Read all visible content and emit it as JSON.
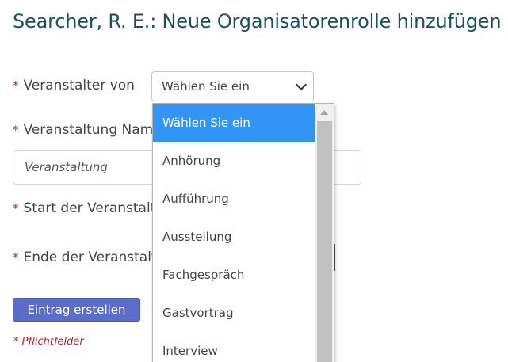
{
  "page": {
    "title": "Searcher, R. E.: Neue Organisatorenrolle hinzufügen"
  },
  "form": {
    "required_marker": "*",
    "organizer_label": "Veranstalter von",
    "organizer_select_value": "Wählen Sie ein",
    "event_name_label": "Veranstaltung Name",
    "event_name_placeholder": "Veranstaltung",
    "start_label": "Start der Veranstaltung",
    "end_label": "Ende der Veranstaltung",
    "submit_label": "Eintrag erstellen",
    "required_note": "* Pflichtfelder"
  },
  "dropdown": {
    "options": [
      "Wählen Sie ein",
      "Anhörung",
      "Aufführung",
      "Ausstellung",
      "Fachgespräch",
      "Gastvortrag",
      "Interview"
    ],
    "selected_index": 0
  },
  "colors": {
    "title": "#1c4f63",
    "required": "#c0202a",
    "button": "#5b6dc8",
    "selected_option": "#3294f6"
  },
  "icons": {
    "select_chevron": "chevron-down-icon",
    "scroll_up": "arrow-up-icon"
  }
}
